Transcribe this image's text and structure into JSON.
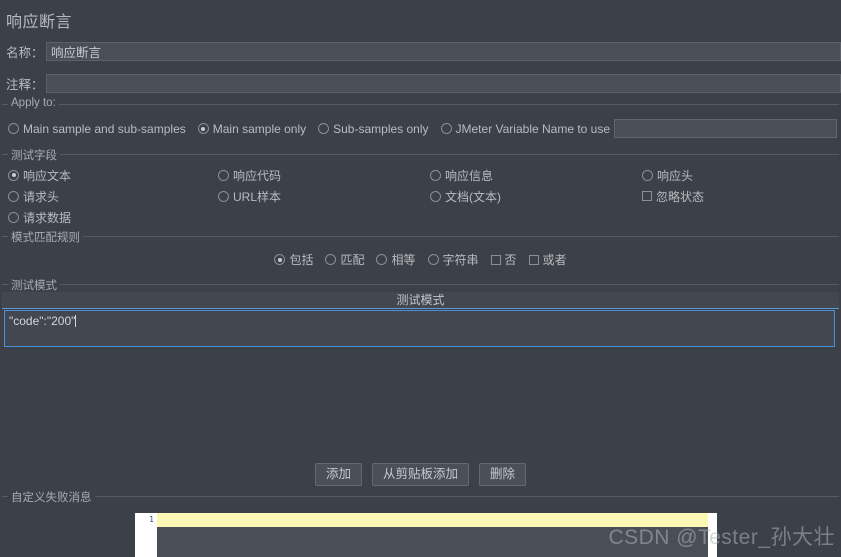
{
  "panel": {
    "title": "响应断言"
  },
  "colors": {
    "background": "#3c4048",
    "input_background": "#4a4f57",
    "focus_border": "#4a90d9",
    "header_underline": "#5c9bd1",
    "highlight_line": "#fbf8b4",
    "text": "#b9bcc0"
  },
  "name_row": {
    "label": "名称：",
    "value": "响应断言",
    "placeholder": ""
  },
  "comment_row": {
    "label": "注释：",
    "value": "",
    "placeholder": ""
  },
  "apply_to": {
    "legend": "Apply to:",
    "options": [
      {
        "label": "Main sample and sub-samples",
        "selected": false
      },
      {
        "label": "Main sample only",
        "selected": true
      },
      {
        "label": "Sub-samples only",
        "selected": false
      },
      {
        "label": "JMeter Variable Name to use",
        "selected": false
      }
    ],
    "variable_input": {
      "value": "",
      "placeholder": ""
    }
  },
  "test_field": {
    "legend": "测试字段",
    "options": [
      {
        "label": "响应文本",
        "type": "radio",
        "selected": true,
        "col": 0,
        "row": 0
      },
      {
        "label": "请求头",
        "type": "radio",
        "selected": false,
        "col": 0,
        "row": 1
      },
      {
        "label": "请求数据",
        "type": "radio",
        "selected": false,
        "col": 0,
        "row": 2
      },
      {
        "label": "响应代码",
        "type": "radio",
        "selected": false,
        "col": 1,
        "row": 0
      },
      {
        "label": "URL样本",
        "type": "radio",
        "selected": false,
        "col": 1,
        "row": 1
      },
      {
        "label": "响应信息",
        "type": "radio",
        "selected": false,
        "col": 2,
        "row": 0
      },
      {
        "label": "文档(文本)",
        "type": "radio",
        "selected": false,
        "col": 2,
        "row": 1
      },
      {
        "label": "响应头",
        "type": "radio",
        "selected": false,
        "col": 3,
        "row": 0
      },
      {
        "label": "忽略状态",
        "type": "checkbox",
        "selected": false,
        "col": 3,
        "row": 1
      }
    ]
  },
  "pattern_rule": {
    "legend": "模式匹配规则",
    "options": [
      {
        "label": "包括",
        "type": "radio",
        "selected": true
      },
      {
        "label": "匹配",
        "type": "radio",
        "selected": false
      },
      {
        "label": "相等",
        "type": "radio",
        "selected": false
      },
      {
        "label": "字符串",
        "type": "radio",
        "selected": false
      },
      {
        "label": "否",
        "type": "checkbox",
        "selected": false
      },
      {
        "label": "或者",
        "type": "checkbox",
        "selected": false
      }
    ]
  },
  "test_pattern": {
    "legend": "测试模式",
    "column_header": "测试模式",
    "value": "\"code\":\"200\"",
    "buttons": [
      {
        "label": "添加"
      },
      {
        "label": "从剪贴板添加"
      },
      {
        "label": "删除"
      }
    ]
  },
  "failure_message": {
    "legend": "自定义失败消息",
    "line_number": "1",
    "value": ""
  },
  "watermark": {
    "text": "CSDN @Tester_孙大壮"
  }
}
